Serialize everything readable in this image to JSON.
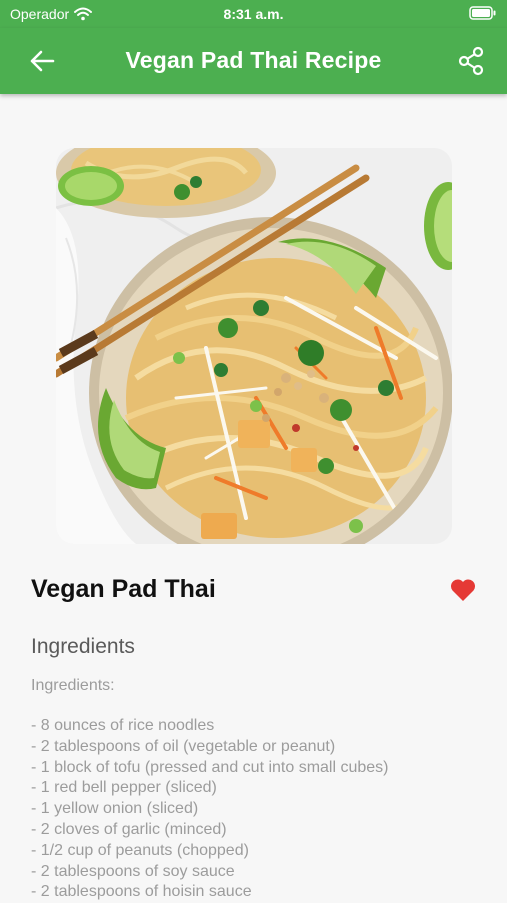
{
  "status_bar": {
    "carrier": "Operador",
    "time": "8:31 a.m."
  },
  "app_bar": {
    "title": "Vegan Pad Thai Recipe",
    "background_color": "#4caf50"
  },
  "recipe": {
    "name": "Vegan Pad Thai",
    "favorite_color": "#e53935",
    "section_heading": "Ingredients",
    "ingredients_label": "Ingredients:",
    "ingredients": [
      "- 8 ounces of rice noodles",
      "- 2 tablespoons of oil (vegetable or peanut)",
      "- 1 block of tofu (pressed and cut into small cubes)",
      "- 1 red bell pepper (sliced)",
      "- 1 yellow onion (sliced)",
      "- 2 cloves of garlic (minced)",
      "- 1/2 cup of peanuts (chopped)",
      "- 2 tablespoons of soy sauce",
      "- 2 tablespoons of hoisin sauce"
    ]
  },
  "icons": {
    "back": "arrow-left-icon",
    "share": "share-icon",
    "favorite": "heart-icon",
    "wifi": "wifi-icon",
    "battery": "battery-icon"
  }
}
